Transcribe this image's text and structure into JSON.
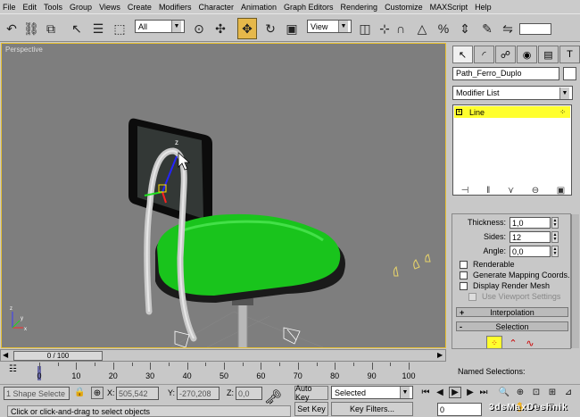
{
  "menu": [
    "File",
    "Edit",
    "Tools",
    "Group",
    "Views",
    "Create",
    "Modifiers",
    "Character",
    "Animation",
    "Graph Editors",
    "Rendering",
    "Customize",
    "MAXScript",
    "Help"
  ],
  "toolbar": {
    "selection_filter": "All",
    "ref_coord": "View"
  },
  "viewport": {
    "label": "Perspective",
    "axis_z": "z",
    "axis_y": "y",
    "axis_x": "x"
  },
  "command_panel": {
    "object_name": "Path_Ferro_Duplo",
    "modifier_list": "Modifier List",
    "stack_item": "Line",
    "thickness_label": "Thickness:",
    "thickness_value": "1,0",
    "sides_label": "Sides:",
    "sides_value": "12",
    "angle_label": "Angle:",
    "angle_value": "0,0",
    "checkbox_renderable": "Renderable",
    "checkbox_mapping": "Generate Mapping Coords.",
    "checkbox_render_mesh": "Display Render Mesh",
    "checkbox_viewport_settings": "Use Viewport Settings",
    "rollout_interpolation": "Interpolation",
    "rollout_selection": "Selection",
    "named_selections": "Named Selections:"
  },
  "timeline": {
    "frame_display": "0 / 100",
    "ticks": [
      "0",
      "10",
      "20",
      "30",
      "40",
      "50",
      "60",
      "70",
      "80",
      "90",
      "100"
    ]
  },
  "status": {
    "selection_count": "1 Shape Selecte",
    "x_label": "X:",
    "x_value": "505,542",
    "y_label": "Y:",
    "y_value": "-270,208",
    "z_label": "Z:",
    "z_value": "0,0",
    "prompt": "Click or click-and-drag to select objects",
    "auto_key": "Auto Key",
    "set_key": "Set Key",
    "key_mode": "Selected",
    "key_filters": "Key Filters...",
    "frame_field": "0"
  },
  "watermark": "3dsMaxDeshnik",
  "colors": {
    "viewport_bg": "#7e7e7e",
    "highlight_yellow": "#ffff2e",
    "active_border": "#e8c030",
    "chair_green": "#19c41c"
  }
}
